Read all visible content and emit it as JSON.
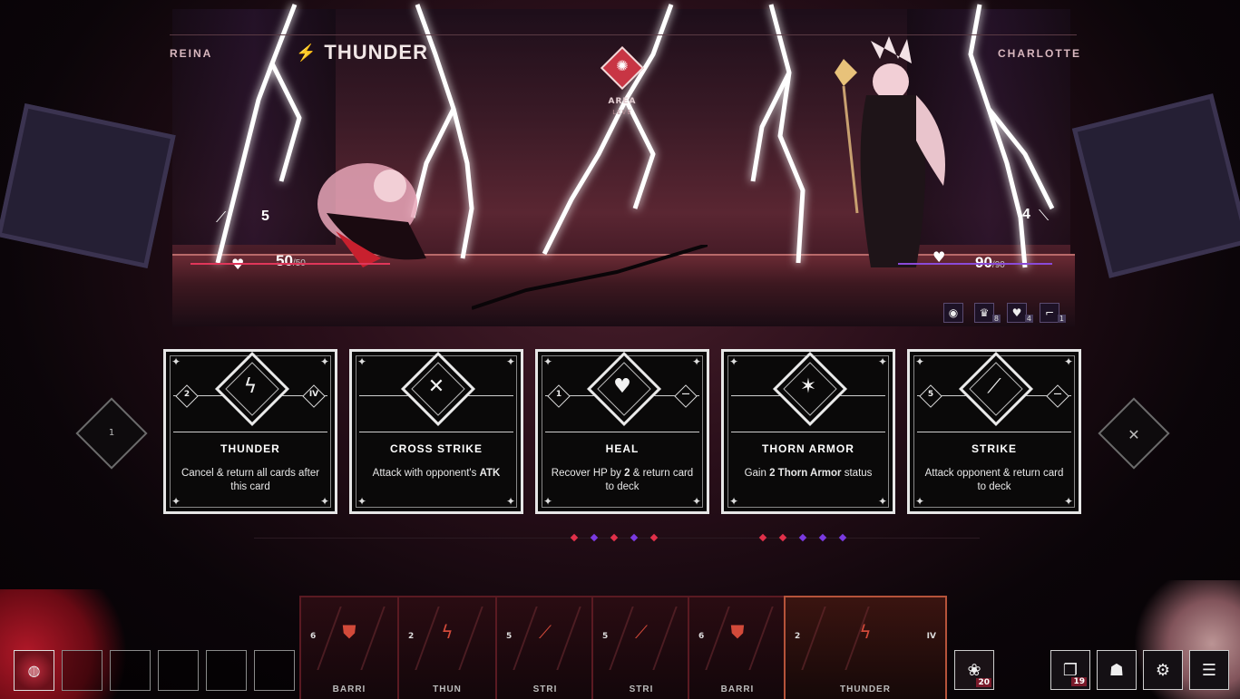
{
  "top_bar": {
    "left_name": "REINA",
    "right_name": "CHARLOTTE",
    "spell_icon": "⚡",
    "spell_name": "THUNDER",
    "area_label": "AREA",
    "area_sub": "LEVE"
  },
  "reina": {
    "atk": "5",
    "hp": "50",
    "hp_max": "50"
  },
  "charlotte": {
    "atk": "4",
    "hp": "90",
    "hp_max": "90"
  },
  "status_effects": [
    {
      "icon": "eye-icon",
      "glyph": "◉",
      "count": ""
    },
    {
      "icon": "crown-icon",
      "glyph": "♛",
      "count": "8"
    },
    {
      "icon": "heart-shield-icon",
      "glyph": "♥",
      "count": "4"
    },
    {
      "icon": "heel-icon",
      "glyph": "⌐",
      "count": "1"
    }
  ],
  "nav": {
    "left_label": "1",
    "right_icon": "cross-swords-icon"
  },
  "cards": [
    {
      "name": "THUNDER",
      "glyph": "ϟ",
      "cost": "2",
      "level": "IV",
      "desc_pre": "Cancel & return all cards after this card",
      "desc_bold": "",
      "desc_post": ""
    },
    {
      "name": "CROSS STRIKE",
      "glyph": "✕",
      "cost": "",
      "level": "",
      "desc_pre": "Attack with opponent's ",
      "desc_bold": "ATK",
      "desc_post": ""
    },
    {
      "name": "HEAL",
      "glyph": "♥",
      "cost": "1",
      "level": "—",
      "desc_pre": "Recover HP by ",
      "desc_bold": "2",
      "desc_post": " & return card to deck"
    },
    {
      "name": "THORN ARMOR",
      "glyph": "✶",
      "cost": "",
      "level": "",
      "desc_pre": "Gain ",
      "desc_bold": "2 Thorn Armor",
      "desc_post": " status"
    },
    {
      "name": "STRIKE",
      "glyph": "⟋",
      "cost": "5",
      "level": "—",
      "desc_pre": "Attack opponent & return card to deck",
      "desc_bold": "",
      "desc_post": ""
    }
  ],
  "hand": [
    {
      "name": "BARRI",
      "cost": "6",
      "icon": "shield-icon",
      "glyph": "⛊",
      "level": ""
    },
    {
      "name": "THUN",
      "cost": "2",
      "icon": "bolt-icon",
      "glyph": "ϟ",
      "level": ""
    },
    {
      "name": "STRI",
      "cost": "5",
      "icon": "sword-icon",
      "glyph": "⟋",
      "level": ""
    },
    {
      "name": "STRI",
      "cost": "5",
      "icon": "sword-icon",
      "glyph": "⟋",
      "level": ""
    },
    {
      "name": "BARRI",
      "cost": "6",
      "icon": "shield-icon",
      "glyph": "⛊",
      "level": ""
    },
    {
      "name": "THUNDER",
      "cost": "2",
      "icon": "bolt-icon",
      "glyph": "ϟ",
      "level": "IV"
    }
  ],
  "deck": {
    "count": "20"
  },
  "right_buttons": [
    {
      "name": "discard-pile",
      "glyph": "❐",
      "count": "19"
    },
    {
      "name": "character",
      "glyph": "☗",
      "count": ""
    },
    {
      "name": "settings",
      "glyph": "⚙",
      "count": ""
    },
    {
      "name": "menu",
      "glyph": "☰",
      "count": ""
    }
  ],
  "colors": {
    "reina_accent": "#e0365a",
    "charlotte_accent": "#8a4ad8",
    "area_badge": "#c83544"
  }
}
